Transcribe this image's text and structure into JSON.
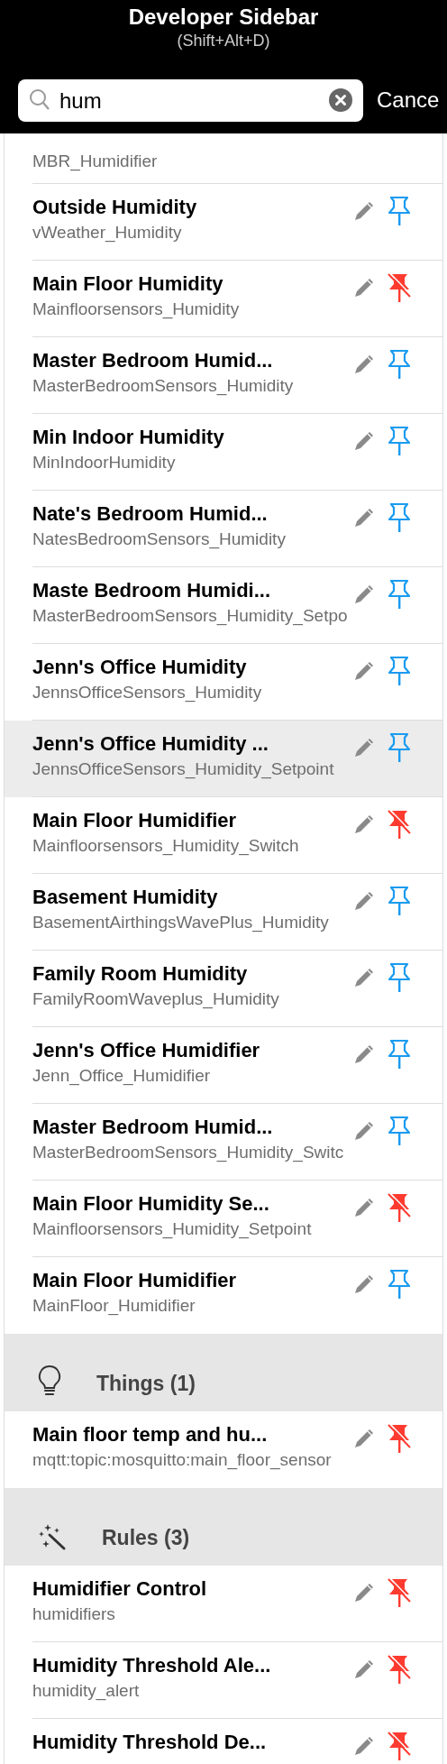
{
  "header": {
    "title": "Developer Sidebar",
    "shortcut": "(Shift+Alt+D)"
  },
  "search": {
    "value": "hum",
    "cancel": "Cance"
  },
  "sections": [
    {
      "kind": "items",
      "entries": [
        {
          "subtitle": "MBR_Humidifier",
          "selected": false
        },
        {
          "title": "Outside Humidity",
          "subtitle": "vWeather_Humidity",
          "pinned": false,
          "selected": false
        },
        {
          "title": "Main Floor Humidity",
          "subtitle": "Mainfloorsensors_Humidity",
          "pinned": true,
          "selected": false
        },
        {
          "title": "Master Bedroom Humid...",
          "subtitle": "MasterBedroomSensors_Humidity",
          "pinned": false,
          "selected": false
        },
        {
          "title": "Min Indoor Humidity",
          "subtitle": "MinIndoorHumidity",
          "pinned": false,
          "selected": false
        },
        {
          "title": "Nate's Bedroom Humid...",
          "subtitle": "NatesBedroomSensors_Humidity",
          "pinned": false,
          "selected": false
        },
        {
          "title": "Maste Bedroom Humidi...",
          "subtitle": "MasterBedroomSensors_Humidity_Setpo",
          "pinned": false,
          "selected": false
        },
        {
          "title": "Jenn's Office Humidity",
          "subtitle": "JennsOfficeSensors_Humidity",
          "pinned": false,
          "selected": false
        },
        {
          "title": "Jenn's Office Humidity ...",
          "subtitle": "JennsOfficeSensors_Humidity_Setpoint",
          "pinned": false,
          "selected": true
        },
        {
          "title": "Main Floor Humidifier",
          "subtitle": "Mainfloorsensors_Humidity_Switch",
          "pinned": true,
          "selected": false
        },
        {
          "title": "Basement Humidity",
          "subtitle": "BasementAirthingsWavePlus_Humidity",
          "pinned": false,
          "selected": false
        },
        {
          "title": "Family Room Humidity",
          "subtitle": "FamilyRoomWaveplus_Humidity",
          "pinned": false,
          "selected": false
        },
        {
          "title": "Jenn's Office Humidifier",
          "subtitle": "Jenn_Office_Humidifier",
          "pinned": false,
          "selected": false
        },
        {
          "title": "Master Bedroom Humid...",
          "subtitle": "MasterBedroomSensors_Humidity_Switc",
          "pinned": false,
          "selected": false
        },
        {
          "title": "Main Floor Humidity Se...",
          "subtitle": "Mainfloorsensors_Humidity_Setpoint",
          "pinned": true,
          "selected": false
        },
        {
          "title": "Main Floor Humidifier",
          "subtitle": "MainFloor_Humidifier",
          "pinned": false,
          "selected": false
        }
      ]
    },
    {
      "kind": "things",
      "heading": "Things (1)",
      "entries": [
        {
          "title": "Main floor temp and hu...",
          "subtitle": "mqtt:topic:mosquitto:main_floor_sensor",
          "pinned": true,
          "selected": false
        }
      ]
    },
    {
      "kind": "rules",
      "heading": "Rules (3)",
      "entries": [
        {
          "title": "Humidifier Control",
          "subtitle": "humidifiers",
          "pinned": true,
          "selected": false
        },
        {
          "title": "Humidity Threshold Ale...",
          "subtitle": "humidity_alert",
          "pinned": true,
          "selected": false
        },
        {
          "title": "Humidity Threshold De...",
          "pinned": true,
          "selected": false
        }
      ]
    }
  ]
}
